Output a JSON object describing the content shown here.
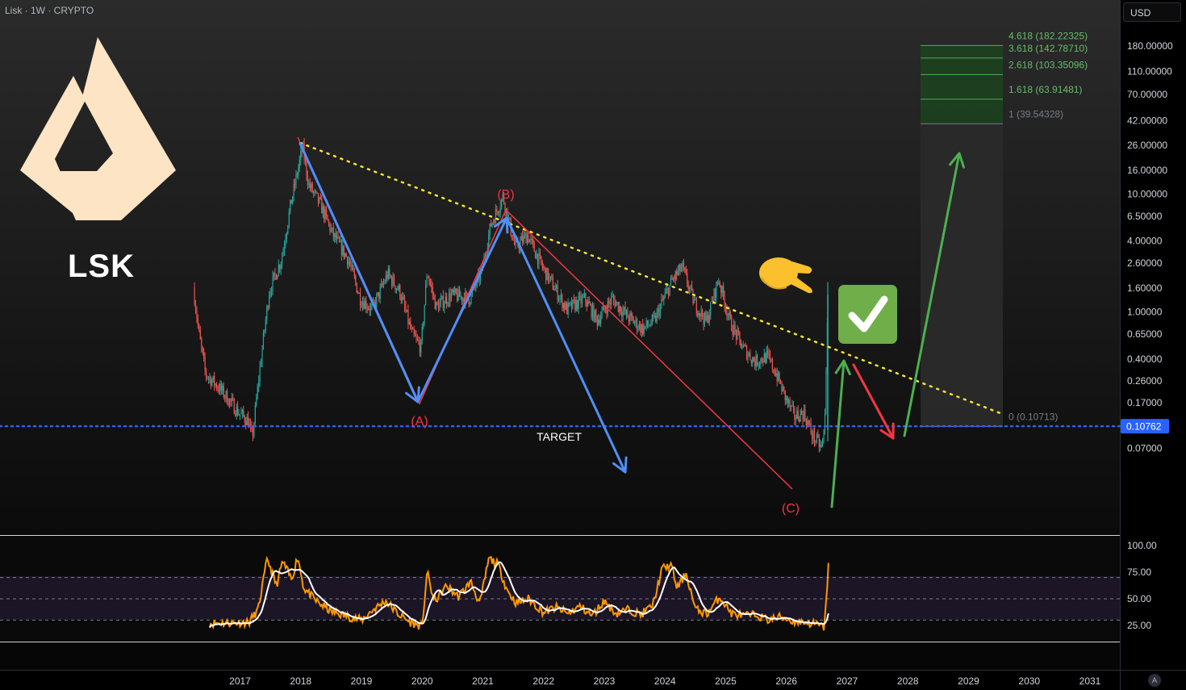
{
  "header": {
    "title": "Lisk · 1W · CRYPTO",
    "currency": "USD"
  },
  "logo": {
    "text": "LSK"
  },
  "colors": {
    "up": "#26a69a",
    "down": "#ef5350",
    "accent_blue": "#2962ff",
    "wave_blue": "#4f8ff7",
    "wave_red": "#f23645",
    "green": "#4caf50",
    "yellow": "#f5e330",
    "rsi": "#ff9800",
    "rsi_ma": "#ffffff"
  },
  "chart_data": {
    "type": "candlestick",
    "y_scale": "log",
    "price_axis_ticks": [
      "180.00000",
      "110.00000",
      "70.00000",
      "42.00000",
      "26.00000",
      "16.00000",
      "10.00000",
      "6.50000",
      "4.00000",
      "2.60000",
      "1.60000",
      "1.00000",
      "0.65000",
      "0.40000",
      "0.26000",
      "0.17000",
      "0.07000"
    ],
    "time_axis_ticks": [
      "2017",
      "2018",
      "2019",
      "2020",
      "2021",
      "2022",
      "2023",
      "2024",
      "2025",
      "2026",
      "2027",
      "2028",
      "2029",
      "2030",
      "2031"
    ],
    "current_price": "0.10762",
    "target_label": "TARGET",
    "wave_labels": [
      "(A)",
      "(B)",
      "(C)"
    ],
    "fib_levels": [
      {
        "label": "4.618 (182.22325)"
      },
      {
        "label": "3.618 (142.78710)"
      },
      {
        "label": "2.618 (103.35096)"
      },
      {
        "label": "1.618 (63.91481)"
      },
      {
        "label": "1 (39.54328)"
      },
      {
        "label": "0 (0.10713)"
      }
    ],
    "rsi_axis_ticks": [
      "100.00",
      "75.00",
      "50.00",
      "25.00"
    ],
    "rsi_levels": [
      70,
      50,
      30
    ]
  }
}
